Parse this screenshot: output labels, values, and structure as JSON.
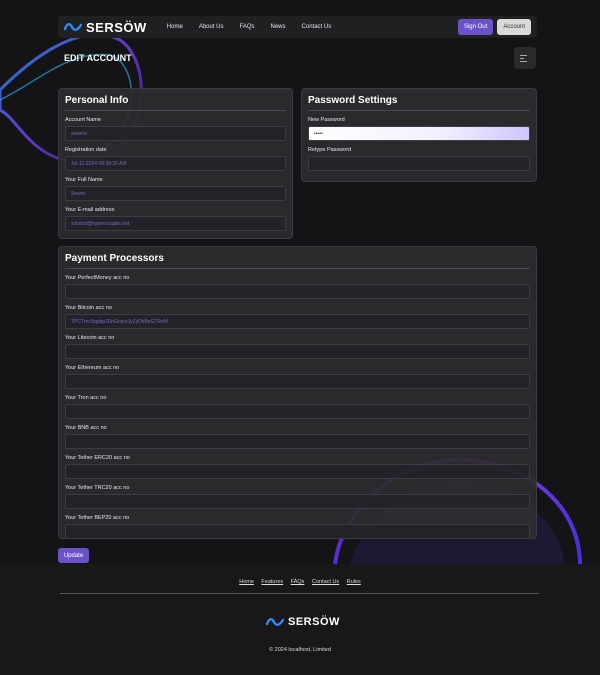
{
  "brand": {
    "name": "SERSÖW"
  },
  "nav": {
    "links": [
      "Home",
      "About Us",
      "FAQs",
      "News",
      "Contact Us"
    ],
    "signout_label": "Sign Out",
    "account_label": "Account"
  },
  "page": {
    "title": "EDIT ACCOUNT"
  },
  "personal": {
    "title": "Personal Info",
    "account_name_label": "Account Name",
    "account_name_value": "sewere",
    "reg_date_label": "Registration date",
    "reg_date_value": "Jul-11-2024 08:39:35 AM",
    "full_name_label": "Your Full Name",
    "full_name_value": "Sewre",
    "email_label": "Your E-mail address",
    "email_value": "sdsdsd@hyperouapbs.net"
  },
  "password": {
    "title": "Password Settings",
    "new_label": "New Password",
    "new_value": "•••••",
    "retype_label": "Retype Password",
    "retype_value": ""
  },
  "payment": {
    "title": "Payment Processors",
    "fields": [
      {
        "label": "Your PerfectMoney acc no",
        "value": ""
      },
      {
        "label": "Your Bitcoin acc no",
        "value": "TPCTmcSqpbpJDnGoyreJyZyDkBeGTRnM"
      },
      {
        "label": "Your Litecoin acc no",
        "value": ""
      },
      {
        "label": "Your Ethereum acc no",
        "value": ""
      },
      {
        "label": "Your Tron acc no",
        "value": ""
      },
      {
        "label": "Your BNB acc no",
        "value": ""
      },
      {
        "label": "Your Tether ERC20 acc no",
        "value": ""
      },
      {
        "label": "Your Tether TRC20 acc no",
        "value": ""
      },
      {
        "label": "Your Tether BEP20 acc no",
        "value": ""
      }
    ]
  },
  "update_label": "Update",
  "footer": {
    "links": [
      "Home",
      "Features",
      "FAQs",
      "Contact Us",
      "Rules"
    ],
    "copyright": "© 2024 localhost, Limited"
  },
  "colors": {
    "accent": "#6b52c8",
    "background": "#141416",
    "card": "#2c2c30"
  }
}
